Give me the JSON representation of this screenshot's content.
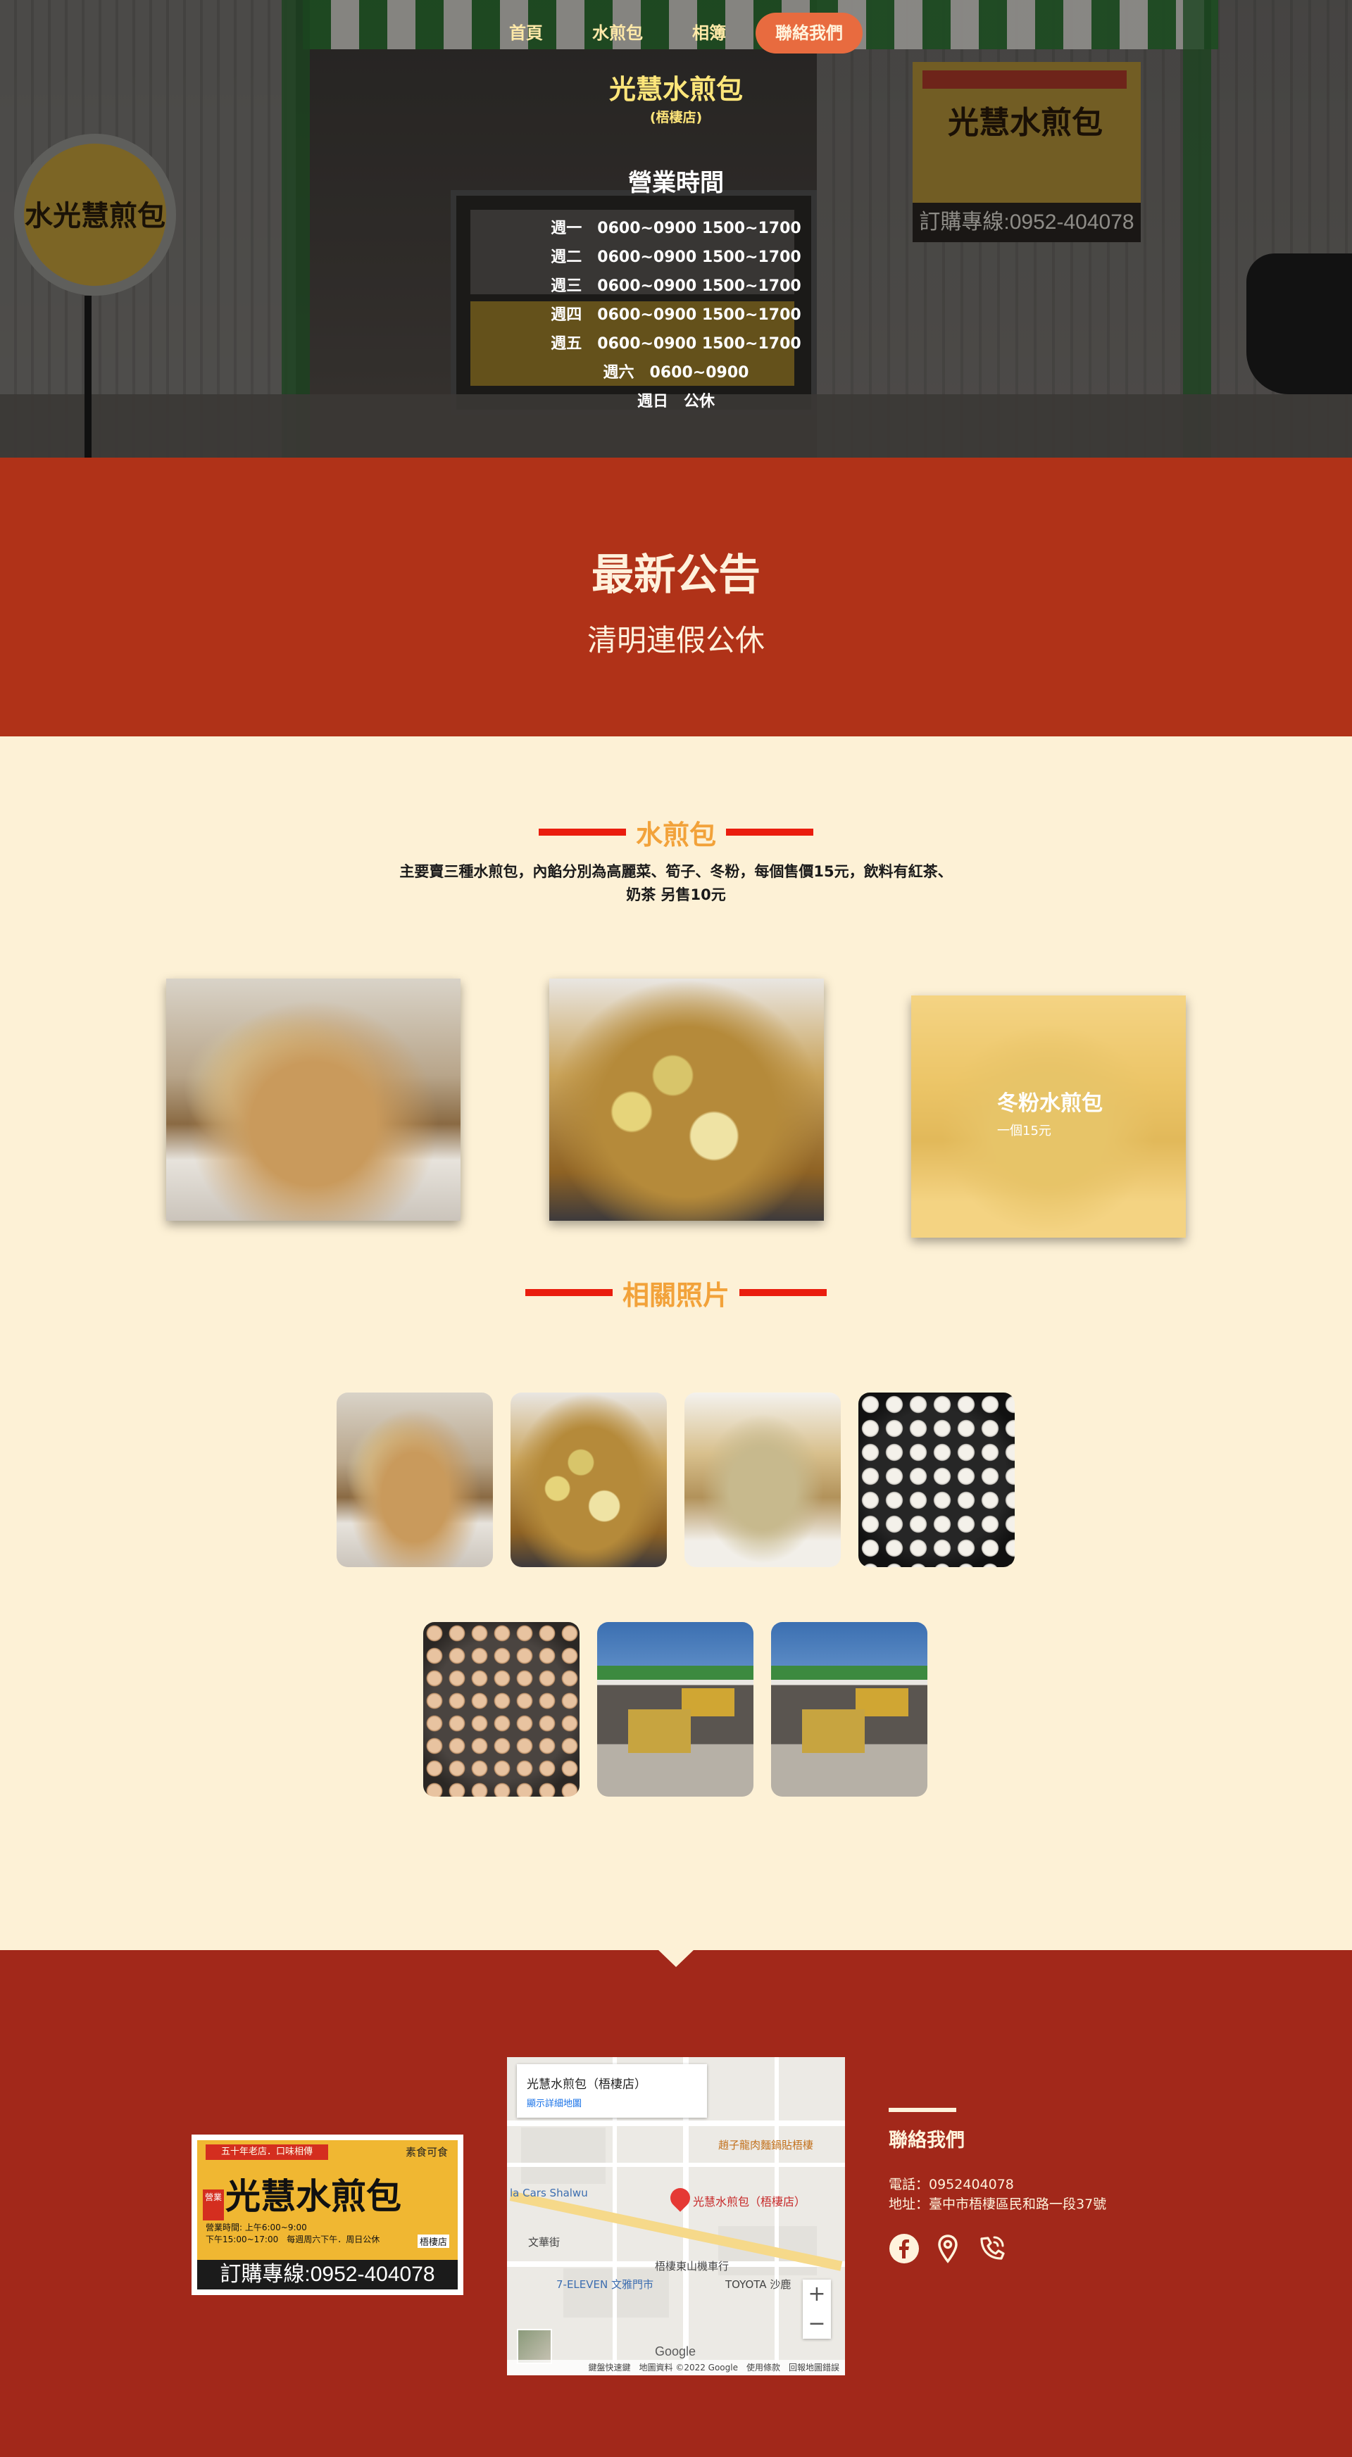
{
  "nav": {
    "items": [
      "首頁",
      "水煎包",
      "相簿",
      "聯絡我們"
    ],
    "active_index": 3
  },
  "hero": {
    "title": "光慧水煎包",
    "subtitle": "(梧棲店)",
    "hours_title": "營業時間",
    "hours": [
      "週一　0600~0900 1500~1700",
      "週二　0600~0900 1500~1700",
      "週三　0600~0900 1500~1700",
      "週四　0600~0900 1500~1700",
      "週五　0600~0900 1500~1700",
      "週六　0600~0900",
      "週日　公休"
    ],
    "circle_sign": "水光慧煎包",
    "board_sign": "光慧水煎包",
    "board_phone": "訂購專線:0952-404078"
  },
  "announcement": {
    "title": "最新公告",
    "text": "清明連假公休"
  },
  "products": {
    "heading": "水煎包",
    "description": "主要賣三種水煎包，內餡分別為高麗菜、筍子、冬粉，每個售價15元，飲料有紅茶、奶茶 另售10元",
    "featured": {
      "title": "冬粉水煎包",
      "price": "一個15元"
    }
  },
  "gallery": {
    "heading": "相關照片"
  },
  "footer": {
    "card": {
      "top_banner": "五十年老店．口味相傳",
      "top_right": "素食可食",
      "badge": "營業",
      "title": "光慧水煎包",
      "hours_line1": "營業時間: 上午6:00~9:00",
      "hours_line2": "下午15:00~17:00　每週周六下午．周日公休",
      "store": "梧棲店",
      "phone": "訂購專線:0952-404078"
    },
    "map": {
      "info_title": "光慧水煎包（梧棲店）",
      "info_link": "顯示詳細地圖",
      "pin_label": "光慧水煎包（梧棲店）",
      "labels": [
        "趙子龍肉麵鍋貼梧棲",
        "la Cars Shalwu",
        "文華街",
        "梧棲東山機車行",
        "7-ELEVEN 文雅門市",
        "TOYOTA 沙鹿"
      ],
      "zoom_in": "+",
      "zoom_out": "−",
      "google": "Google",
      "footer": "鍵盤快速鍵　地圖資料 ©2022 Google　使用條款　回報地圖錯誤"
    },
    "contact": {
      "title": "聯絡我們",
      "phone": "電話：0952404078",
      "address": "地址：臺中市梧棲區民和路一段37號"
    }
  }
}
